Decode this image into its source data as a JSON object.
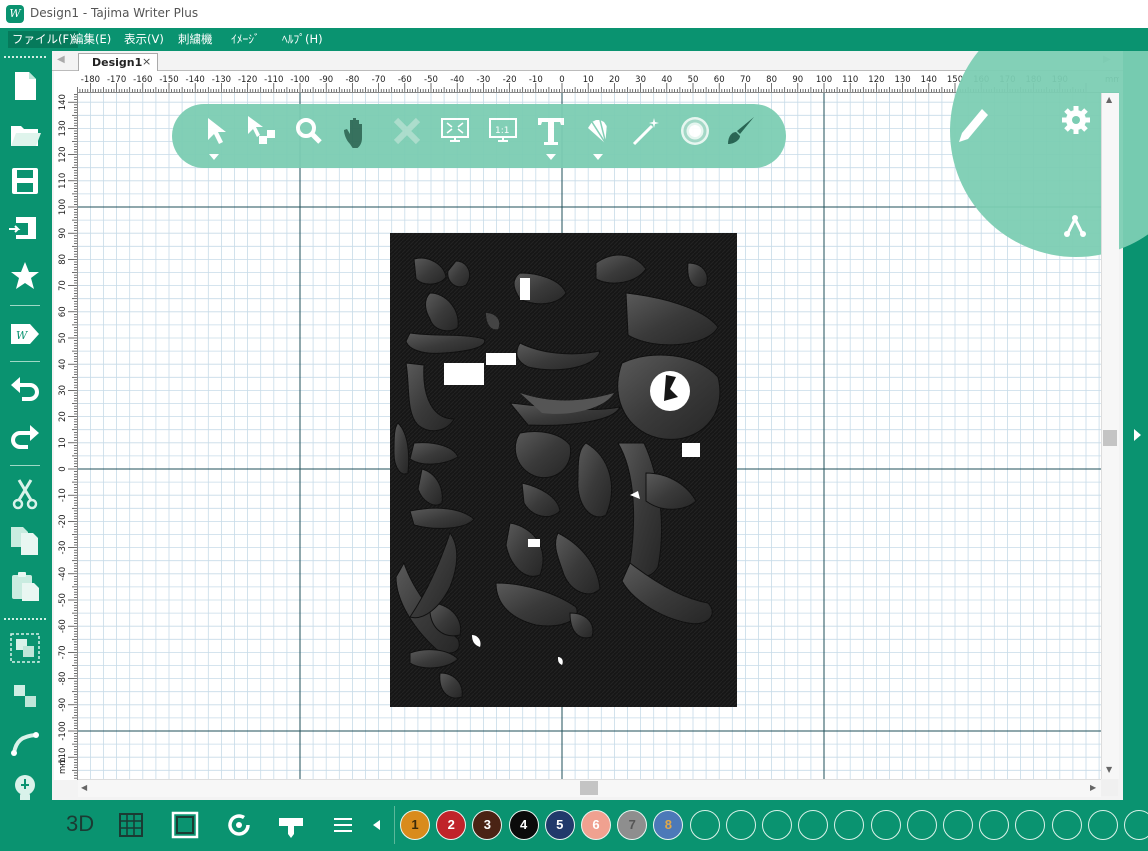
{
  "window": {
    "title": "Design1 - Tajima Writer Plus",
    "icon": "app-logo-icon"
  },
  "menu": [
    {
      "label": "ファイル(F)",
      "active": true
    },
    {
      "label": "編集(E)"
    },
    {
      "label": "表示(V)"
    },
    {
      "label": "刺繍機"
    },
    {
      "label": "ｲﾒｰｼﾞ"
    },
    {
      "label": "ﾍﾙﾌﾟ(H)"
    }
  ],
  "tab": {
    "label": "Design1",
    "close": "×"
  },
  "ruler": {
    "unit": "mm",
    "h_labels": [
      "-180",
      "-170",
      "-160",
      "-150",
      "-140",
      "-130",
      "-120",
      "-110",
      "-100",
      "-90",
      "-80",
      "-70",
      "-60",
      "-50",
      "-40",
      "-30",
      "-20",
      "-10",
      "0",
      "10",
      "20",
      "30",
      "40",
      "50",
      "60",
      "70",
      "80",
      "90",
      "100",
      "110",
      "120",
      "130",
      "140",
      "150",
      "160",
      "170",
      "180",
      "190"
    ],
    "v_labels": [
      "140",
      "130",
      "120",
      "110",
      "100",
      "90",
      "80",
      "70",
      "60",
      "50",
      "40",
      "30",
      "20",
      "10",
      "0",
      "-10",
      "-20",
      "-30",
      "-40",
      "-50",
      "-60",
      "-70",
      "-80",
      "-90",
      "-100",
      "-110"
    ]
  },
  "left_toolbar": [
    "new-file-icon",
    "open-folder-icon",
    "save-icon",
    "send-to-machine-icon",
    "star-icon",
    "export-writer-icon",
    "undo-icon",
    "redo-icon",
    "cut-icon",
    "copy-icon",
    "paste-icon",
    "group-icon",
    "ungroup-icon",
    "path-icon",
    "bulb-icon"
  ],
  "float_toolbar": [
    "select-arrow-icon",
    "node-select-icon",
    "zoom-icon",
    "pan-hand-icon",
    "delete-x-icon",
    "fit-screen-icon",
    "actual-size-icon",
    "text-tool-icon",
    "fan-effect-icon",
    "magic-wand-icon",
    "sphere-icon",
    "brush-icon"
  ],
  "circle_panel": [
    "pencil-icon",
    "settings-gear-icon",
    "branch-icon"
  ],
  "bottom_toolbar": {
    "view3d_label": "3D",
    "tools": [
      "grid-toggle-icon",
      "frame-icon",
      "refresh-icon",
      "needle-icon",
      "list-icon",
      "palette-prev-icon"
    ]
  },
  "colors": {
    "brand": "#0a9370",
    "float_toolbar": "#7ccdb3",
    "grid_minor": "#c7dbe8",
    "grid_major": "#1f4f58",
    "embroidery_bg": "#161616"
  },
  "palette": [
    {
      "num": "1",
      "color": "#d98b1c",
      "text": "#3b2a0a"
    },
    {
      "num": "2",
      "color": "#c0232a",
      "text": "#ffffff"
    },
    {
      "num": "3",
      "color": "#4a2314",
      "text": "#ffffff"
    },
    {
      "num": "4",
      "color": "#0b0b0b",
      "text": "#ffffff"
    },
    {
      "num": "5",
      "color": "#213a6b",
      "text": "#ffffff"
    },
    {
      "num": "6",
      "color": "#f0a190",
      "text": "#ffffff"
    },
    {
      "num": "7",
      "color": "#8e8e8e",
      "text": "#555555"
    },
    {
      "num": "8",
      "color": "#4c79b8",
      "text": "#e0a84a"
    },
    {
      "num": ""
    },
    {
      "num": ""
    },
    {
      "num": ""
    },
    {
      "num": ""
    },
    {
      "num": ""
    },
    {
      "num": ""
    },
    {
      "num": ""
    },
    {
      "num": ""
    },
    {
      "num": ""
    },
    {
      "num": ""
    },
    {
      "num": ""
    },
    {
      "num": ""
    },
    {
      "num": ""
    },
    {
      "num": ""
    }
  ]
}
